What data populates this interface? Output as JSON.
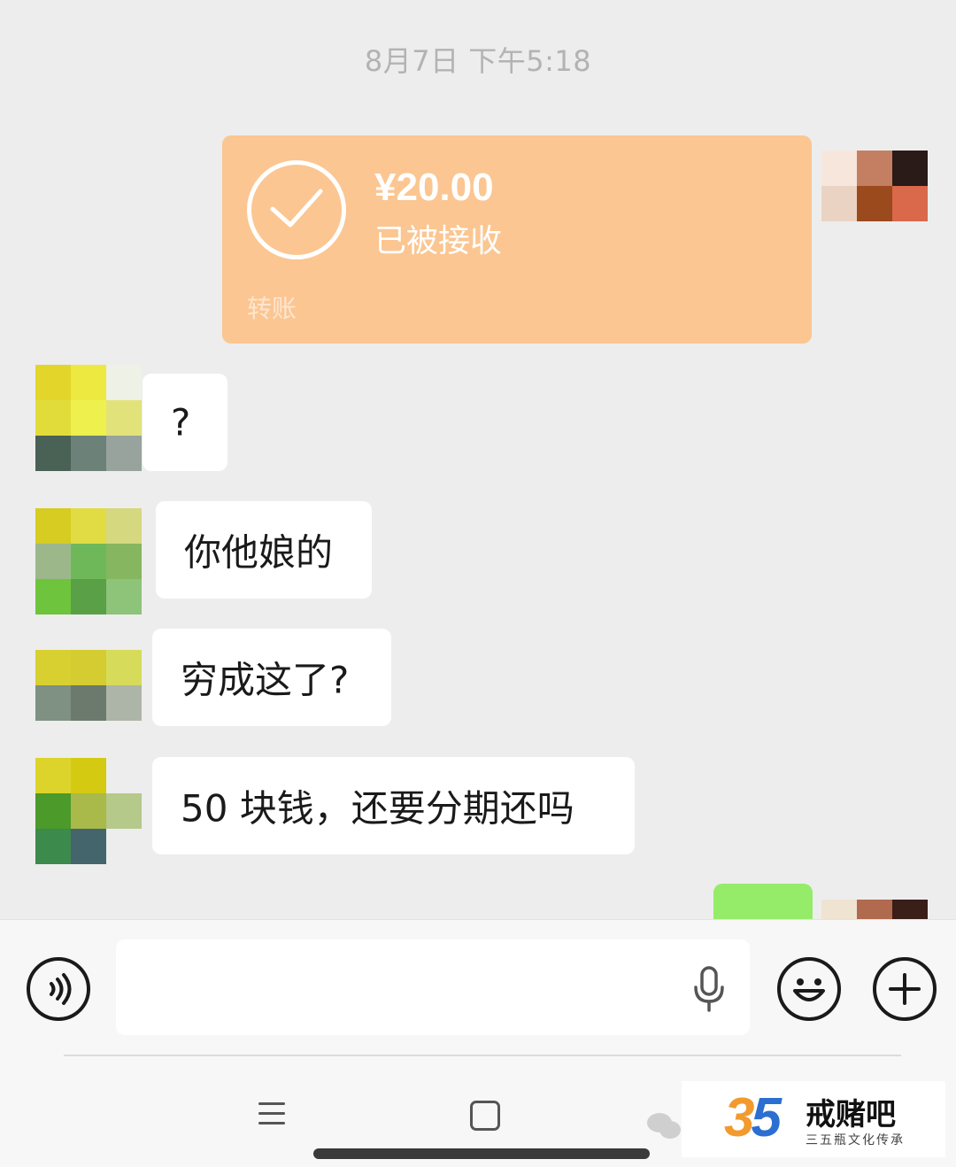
{
  "timestamp": "8月7日 下午5:18",
  "transfer": {
    "amount": "¥20.00",
    "status": "已被接收",
    "label": "转账",
    "icon": "check-circle-icon"
  },
  "messages": [
    {
      "text": "?"
    },
    {
      "text": "你他娘的"
    },
    {
      "text": "穷成这了?"
    },
    {
      "text": "50 块钱，还要分期还吗"
    }
  ],
  "input_bar": {
    "voice_icon": "voice-icon",
    "mic_icon": "microphone-icon",
    "emoji_icon": "emoji-icon",
    "plus_icon": "plus-icon"
  },
  "watermark": {
    "number_3": "3",
    "number_5": "5",
    "title": "戒赌吧",
    "subtitle": "三五瓶文化传承"
  },
  "colors": {
    "background": "#ededed",
    "transfer_card": "#fbc691",
    "bubble_received": "#ffffff",
    "bubble_sent": "#95ec69"
  }
}
